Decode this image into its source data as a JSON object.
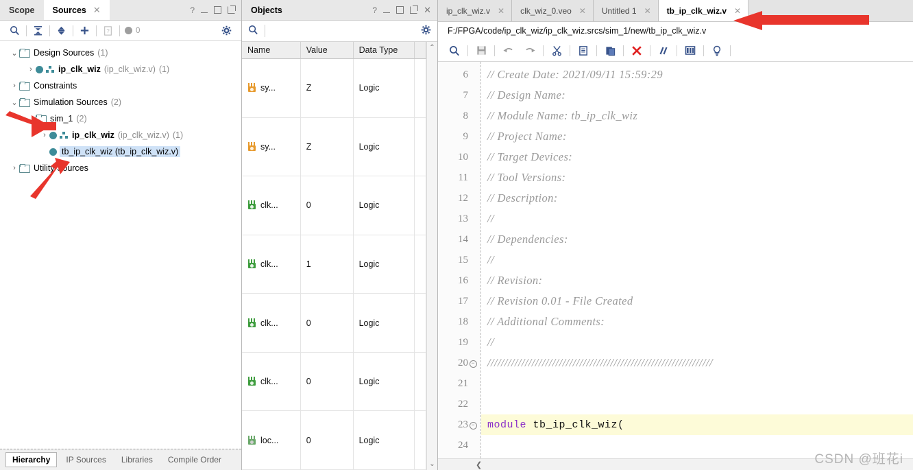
{
  "sources_panel": {
    "tabs": [
      {
        "label": "Scope",
        "active": false,
        "closable": false
      },
      {
        "label": "Sources",
        "active": true,
        "closable": true
      }
    ],
    "window_controls": [
      "?",
      "minimize",
      "maximize",
      "float"
    ],
    "toolbar": {
      "search": "search-icon",
      "collapse_all": "collapse-all-icon",
      "expand": "expand-icon",
      "add": "plus-icon",
      "report": "report-icon",
      "status_count": "0",
      "settings": "gear-icon"
    },
    "tree": [
      {
        "indent": 0,
        "arrow": "down",
        "icon": "folder",
        "name": "Design Sources",
        "detail": "",
        "count": "(1)",
        "bold": false,
        "selected": false
      },
      {
        "indent": 1,
        "arrow": "right",
        "icon": "module",
        "name": "ip_clk_wiz",
        "detail": "(ip_clk_wiz.v)",
        "count": "(1)",
        "bold": true,
        "selected": false
      },
      {
        "indent": 0,
        "arrow": "right",
        "icon": "folder",
        "name": "Constraints",
        "detail": "",
        "count": "",
        "bold": false,
        "selected": false
      },
      {
        "indent": 0,
        "arrow": "down",
        "icon": "folder",
        "name": "Simulation Sources",
        "detail": "",
        "count": "(2)",
        "bold": false,
        "selected": false
      },
      {
        "indent": 1,
        "arrow": "none",
        "icon": "folder",
        "name": "sim_1",
        "detail": "",
        "count": "(2)",
        "bold": false,
        "selected": false
      },
      {
        "indent": 2,
        "arrow": "right",
        "icon": "module",
        "name": "ip_clk_wiz",
        "detail": "(ip_clk_wiz.v)",
        "count": "(1)",
        "bold": true,
        "selected": false
      },
      {
        "indent": 2,
        "arrow": "none",
        "icon": "dot",
        "name": "tb_ip_clk_wiz",
        "detail": "(tb_ip_clk_wiz.v)",
        "count": "",
        "bold": false,
        "selected": true
      },
      {
        "indent": 0,
        "arrow": "right",
        "icon": "folder",
        "name": "Utility Sources",
        "detail": "",
        "count": "",
        "bold": false,
        "selected": false
      }
    ],
    "bottom_tabs": [
      {
        "label": "Hierarchy",
        "active": true
      },
      {
        "label": "IP Sources",
        "active": false
      },
      {
        "label": "Libraries",
        "active": false
      },
      {
        "label": "Compile Order",
        "active": false
      }
    ]
  },
  "objects_panel": {
    "title": "Objects",
    "window_controls": [
      "?",
      "minimize",
      "maximize",
      "float",
      "close"
    ],
    "search_placeholder": "",
    "columns": [
      "Name",
      "Value",
      "Data Type"
    ],
    "rows": [
      {
        "name": "sy...",
        "value": "Z",
        "type": "Logic",
        "icon": "signal-orange"
      },
      {
        "name": "sy...",
        "value": "Z",
        "type": "Logic",
        "icon": "signal-orange"
      },
      {
        "name": "clk...",
        "value": "0",
        "type": "Logic",
        "icon": "signal-green"
      },
      {
        "name": "clk...",
        "value": "1",
        "type": "Logic",
        "icon": "signal-green"
      },
      {
        "name": "clk...",
        "value": "0",
        "type": "Logic",
        "icon": "signal-green"
      },
      {
        "name": "clk...",
        "value": "0",
        "type": "Logic",
        "icon": "signal-green"
      },
      {
        "name": "loc...",
        "value": "0",
        "type": "Logic",
        "icon": "signal-gray"
      }
    ]
  },
  "editor": {
    "tabs": [
      {
        "label": "ip_clk_wiz.v",
        "active": false
      },
      {
        "label": "clk_wiz_0.veo",
        "active": false
      },
      {
        "label": "Untitled 1",
        "active": false
      },
      {
        "label": "tb_ip_clk_wiz.v",
        "active": true
      }
    ],
    "file_path": "F:/FPGA/code/ip_clk_wiz/ip_clk_wiz.srcs/sim_1/new/tb_ip_clk_wiz.v",
    "toolbar": [
      "search-icon",
      "save-icon",
      "undo-icon",
      "redo-icon",
      "cut-icon",
      "copy-icon",
      "paste-icon",
      "delete-icon",
      "comment-icon",
      "columns-icon",
      "bulb-icon"
    ],
    "lines": [
      {
        "num": "6",
        "fold": false,
        "highlight": false,
        "kind": "comment",
        "text": "// Create Date: 2021/09/11 15:59:29"
      },
      {
        "num": "7",
        "fold": false,
        "highlight": false,
        "kind": "comment",
        "text": "// Design Name: "
      },
      {
        "num": "8",
        "fold": false,
        "highlight": false,
        "kind": "comment",
        "text": "// Module Name: tb_ip_clk_wiz"
      },
      {
        "num": "9",
        "fold": false,
        "highlight": false,
        "kind": "comment",
        "text": "// Project Name: "
      },
      {
        "num": "10",
        "fold": false,
        "highlight": false,
        "kind": "comment",
        "text": "// Target Devices: "
      },
      {
        "num": "11",
        "fold": false,
        "highlight": false,
        "kind": "comment",
        "text": "// Tool Versions: "
      },
      {
        "num": "12",
        "fold": false,
        "highlight": false,
        "kind": "comment",
        "text": "// Description: "
      },
      {
        "num": "13",
        "fold": false,
        "highlight": false,
        "kind": "comment",
        "text": "// "
      },
      {
        "num": "14",
        "fold": false,
        "highlight": false,
        "kind": "comment",
        "text": "// Dependencies: "
      },
      {
        "num": "15",
        "fold": false,
        "highlight": false,
        "kind": "comment",
        "text": "// "
      },
      {
        "num": "16",
        "fold": false,
        "highlight": false,
        "kind": "comment",
        "text": "// Revision:"
      },
      {
        "num": "17",
        "fold": false,
        "highlight": false,
        "kind": "comment",
        "text": "// Revision 0.01 - File Created"
      },
      {
        "num": "18",
        "fold": false,
        "highlight": false,
        "kind": "comment",
        "text": "// Additional Comments:"
      },
      {
        "num": "19",
        "fold": false,
        "highlight": false,
        "kind": "comment",
        "text": "// "
      },
      {
        "num": "20",
        "fold": true,
        "highlight": false,
        "kind": "comment",
        "text": "//////////////////////////////////////////////////////////////////"
      },
      {
        "num": "21",
        "fold": false,
        "highlight": false,
        "kind": "blank",
        "text": ""
      },
      {
        "num": "22",
        "fold": false,
        "highlight": false,
        "kind": "blank",
        "text": ""
      },
      {
        "num": "23",
        "fold": true,
        "highlight": true,
        "kind": "code",
        "keyword": "module",
        "text": " tb_ip_clk_wiz("
      },
      {
        "num": "24",
        "fold": false,
        "highlight": false,
        "kind": "blank",
        "text": ""
      }
    ]
  },
  "watermark": "CSDN @班花i",
  "annotations": {
    "arrow_color": "#e8352c",
    "arrows": [
      {
        "name": "arrow-to-sim_1"
      },
      {
        "name": "arrow-to-tb-file"
      },
      {
        "name": "arrow-to-active-tab"
      }
    ]
  }
}
